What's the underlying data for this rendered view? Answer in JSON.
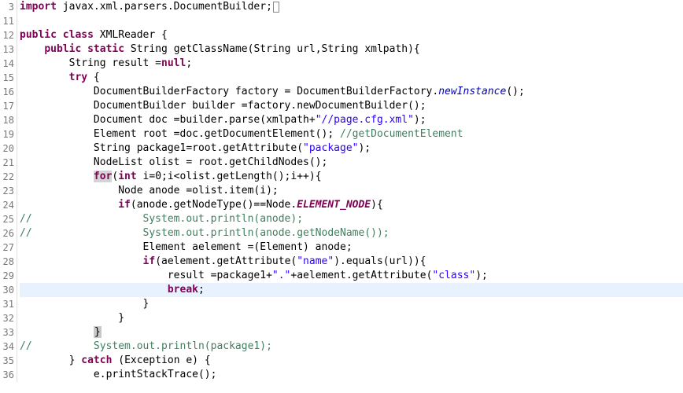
{
  "lines": [
    {
      "num": "3",
      "marked": true,
      "segs": [
        {
          "c": "kw",
          "t": "import"
        },
        {
          "t": " javax.xml.parsers.DocumentBuilder;"
        },
        {
          "cursor": true
        }
      ]
    },
    {
      "num": "11",
      "segs": []
    },
    {
      "num": "12",
      "segs": [
        {
          "c": "kw",
          "t": "public"
        },
        {
          "t": " "
        },
        {
          "c": "kw",
          "t": "class"
        },
        {
          "t": " XMLReader {"
        }
      ]
    },
    {
      "num": "13",
      "marked": true,
      "segs": [
        {
          "t": "    "
        },
        {
          "c": "kw",
          "t": "public"
        },
        {
          "t": " "
        },
        {
          "c": "kw",
          "t": "static"
        },
        {
          "t": " String getClassName(String url,String xmlpath){"
        }
      ]
    },
    {
      "num": "14",
      "segs": [
        {
          "t": "        String result ="
        },
        {
          "c": "kw",
          "t": "null"
        },
        {
          "t": ";"
        }
      ]
    },
    {
      "num": "15",
      "segs": [
        {
          "t": "        "
        },
        {
          "c": "kw",
          "t": "try"
        },
        {
          "t": " {"
        }
      ]
    },
    {
      "num": "16",
      "segs": [
        {
          "t": "            DocumentBuilderFactory factory = DocumentBuilderFactory."
        },
        {
          "c": "stat-it",
          "t": "newInstance"
        },
        {
          "t": "();"
        }
      ]
    },
    {
      "num": "17",
      "segs": [
        {
          "t": "            DocumentBuilder builder =factory.newDocumentBuilder();"
        }
      ]
    },
    {
      "num": "18",
      "segs": [
        {
          "t": "            Document doc =builder.parse(xmlpath+"
        },
        {
          "c": "str",
          "t": "\"//page.cfg.xml\""
        },
        {
          "t": ");"
        }
      ]
    },
    {
      "num": "19",
      "segs": [
        {
          "t": "            Element root =doc.getDocumentElement(); "
        },
        {
          "c": "com",
          "t": "//getDocumentElement"
        }
      ]
    },
    {
      "num": "20",
      "segs": [
        {
          "t": "            String package1=root.getAttribute("
        },
        {
          "c": "str",
          "t": "\"package\""
        },
        {
          "t": ");"
        }
      ]
    },
    {
      "num": "21",
      "segs": [
        {
          "t": "            NodeList olist = root.getChildNodes();"
        }
      ]
    },
    {
      "num": "22",
      "segs": [
        {
          "t": "            "
        },
        {
          "c": "kw hl-y",
          "t": "for"
        },
        {
          "t": "("
        },
        {
          "c": "kw",
          "t": "int"
        },
        {
          "t": " i=0;i<olist.getLength();i++){"
        }
      ]
    },
    {
      "num": "23",
      "segs": [
        {
          "t": "                Node anode =olist.item(i);"
        }
      ]
    },
    {
      "num": "24",
      "segs": [
        {
          "t": "                "
        },
        {
          "c": "kw",
          "t": "if"
        },
        {
          "t": "(anode.getNodeType()==Node."
        },
        {
          "c": "field-it",
          "t": "ELEMENT_NODE"
        },
        {
          "t": "){"
        }
      ]
    },
    {
      "num": "25",
      "segs": [
        {
          "c": "com",
          "t": "//                  System.out.println(anode);"
        }
      ]
    },
    {
      "num": "26",
      "segs": [
        {
          "c": "com",
          "t": "//                  System.out.println(anode.getNodeName());"
        }
      ]
    },
    {
      "num": "27",
      "segs": [
        {
          "t": "                    Element aelement =(Element) anode;"
        }
      ]
    },
    {
      "num": "28",
      "segs": [
        {
          "t": "                    "
        },
        {
          "c": "kw",
          "t": "if"
        },
        {
          "t": "(aelement.getAttribute("
        },
        {
          "c": "str",
          "t": "\"name\""
        },
        {
          "t": ").equals(url)){"
        }
      ]
    },
    {
      "num": "29",
      "segs": [
        {
          "t": "                        result =package1+"
        },
        {
          "c": "str",
          "t": "\".\""
        },
        {
          "t": "+aelement.getAttribute("
        },
        {
          "c": "str",
          "t": "\"class\""
        },
        {
          "t": ");"
        }
      ]
    },
    {
      "num": "30",
      "hl": true,
      "segs": [
        {
          "t": "                        "
        },
        {
          "c": "kw",
          "t": "break"
        },
        {
          "t": ";"
        }
      ]
    },
    {
      "num": "31",
      "segs": [
        {
          "t": "                    }"
        }
      ]
    },
    {
      "num": "32",
      "segs": [
        {
          "t": "                }"
        }
      ]
    },
    {
      "num": "33",
      "segs": [
        {
          "t": "            "
        },
        {
          "c": "hl-box",
          "t": "}"
        }
      ]
    },
    {
      "num": "34",
      "segs": [
        {
          "c": "com",
          "t": "//          System.out.println(package1);"
        }
      ]
    },
    {
      "num": "35",
      "segs": [
        {
          "t": "        } "
        },
        {
          "c": "kw",
          "t": "catch"
        },
        {
          "t": " (Exception e) {"
        }
      ]
    },
    {
      "num": "36",
      "segs": [
        {
          "t": "            e.printStackTrace();"
        }
      ]
    }
  ]
}
